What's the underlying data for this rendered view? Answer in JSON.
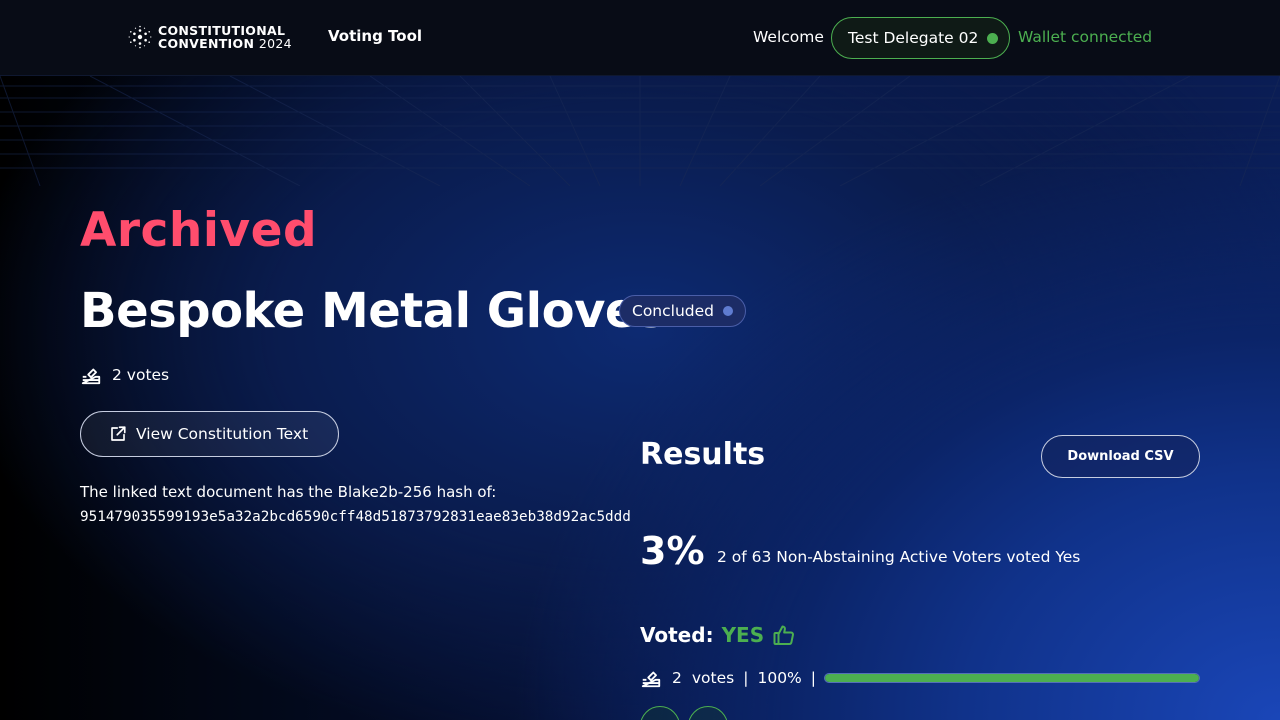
{
  "header": {
    "logo_line1": "CONSTITUTIONAL",
    "logo_line2_bold": "CONVENTION",
    "logo_line2_year": "2024",
    "nav_title": "Voting Tool",
    "welcome": "Welcome",
    "delegate_name": "Test Delegate 02",
    "wallet_status": "Wallet connected",
    "status_color": "#4caf50"
  },
  "proposal": {
    "state": "Archived",
    "state_color": "#ff4d6d",
    "title": "Bespoke Metal Gloves",
    "status_badge": "Concluded",
    "votes_count": "2 votes",
    "view_button": "View Constitution Text",
    "hash_label": "The linked text document has the Blake2b-256 hash of:",
    "hash_value": "951479035599193e5a32a2bcd6590cff48d51873792831eae83eb38d92ac5ddd"
  },
  "results": {
    "title": "Results",
    "download_button": "Download CSV",
    "percentage": "3%",
    "summary": "2 of 63 Non-Abstaining Active Voters voted Yes",
    "voted_label": "Voted:",
    "voted_value": "YES",
    "tally_votes_num": "2",
    "tally_votes_word": "votes",
    "tally_percent": "100%",
    "tally_fill_fraction": 1.0,
    "tally_color": "#4caf50"
  },
  "icons": {
    "ballot": "ballot-box-icon",
    "external_link": "external-link-icon",
    "thumbs_up": "thumbs-up-icon"
  }
}
